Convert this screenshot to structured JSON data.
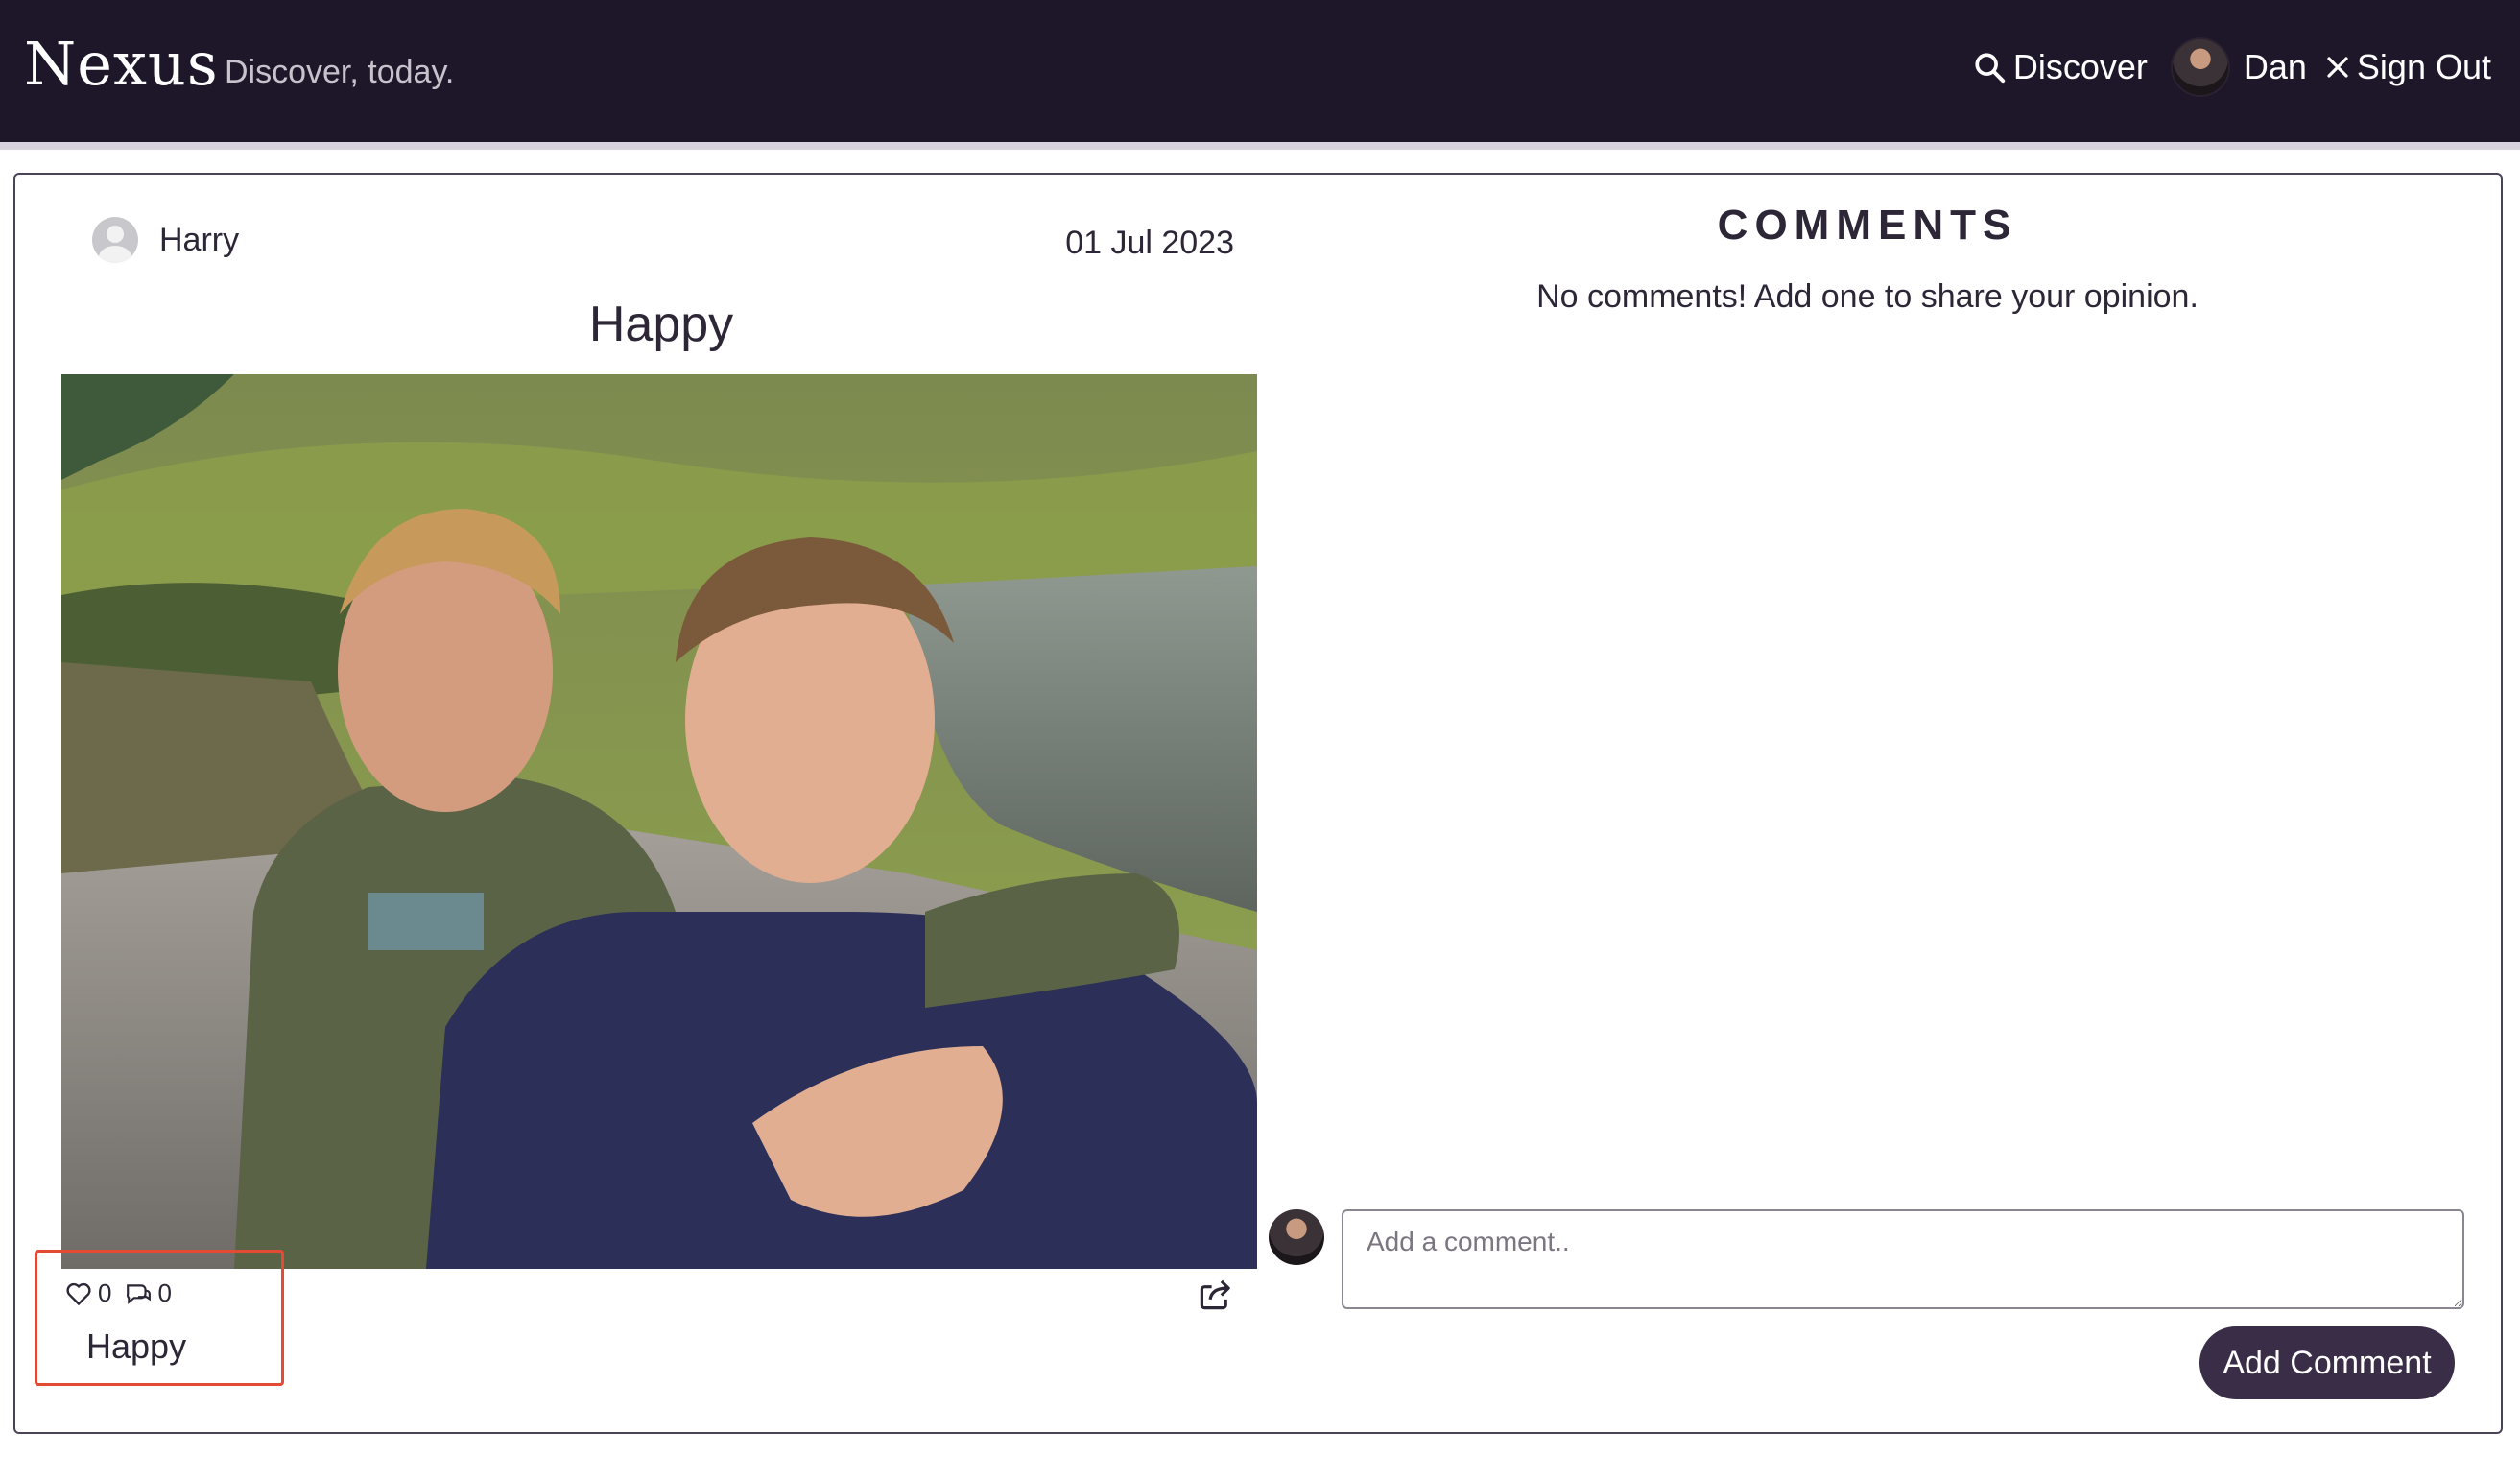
{
  "navbar": {
    "brand": "Nexus",
    "tagline": "Discover, today.",
    "discover_label": "Discover",
    "user_name": "Dan",
    "sign_out_label": "Sign Out"
  },
  "post": {
    "author": "Harry",
    "date": "01 Jul 2023",
    "title": "Happy",
    "likes": "0",
    "comments_count": "0",
    "caption": "Happy"
  },
  "comments": {
    "heading": "COMMENTS",
    "empty_message": "No comments! Add one to share your opinion.",
    "input_placeholder": "Add a comment..",
    "submit_label": "Add Comment"
  },
  "colors": {
    "navbar_bg": "#1e1629",
    "accent_button": "#3a2d47",
    "highlight_border": "#e34b35"
  },
  "icons": {
    "discover": "search-icon",
    "sign_out": "close-icon",
    "like": "heart-icon",
    "comment": "comment-icon",
    "share": "share-icon"
  }
}
